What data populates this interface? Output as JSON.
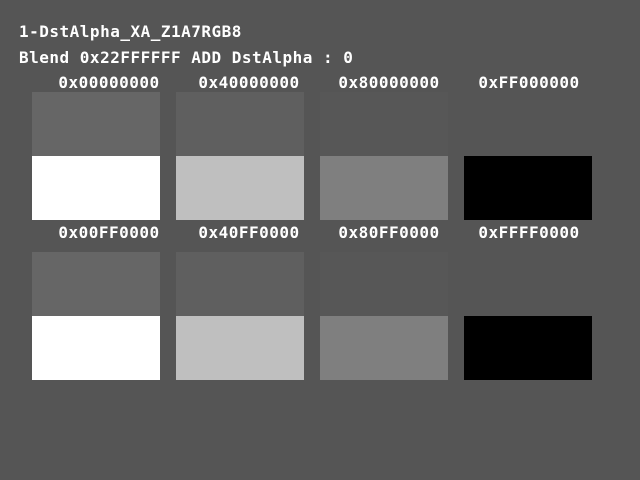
{
  "screen": {
    "title": "1-DstAlpha_XA_Z1A7RGB8",
    "blend_line": "Blend 0x22FFFFFF ADD DstAlpha : 0"
  },
  "colors": {
    "background": "#555555",
    "text": "#ffffff",
    "top_swatches": [
      "#666666",
      "#5f5f5f",
      "#575757",
      "#555555"
    ],
    "bottom_swatches": [
      "#ffffff",
      "#bfbfbf",
      "#7f7f7f",
      "#000000"
    ]
  },
  "grid": {
    "rows": [
      {
        "labels": [
          "0x00000000",
          "0x40000000",
          "0x80000000",
          "0xFF000000"
        ]
      },
      {
        "labels": [
          "0x00FF0000",
          "0x40FF0000",
          "0x80FF0000",
          "0xFFFF0000"
        ]
      }
    ]
  }
}
